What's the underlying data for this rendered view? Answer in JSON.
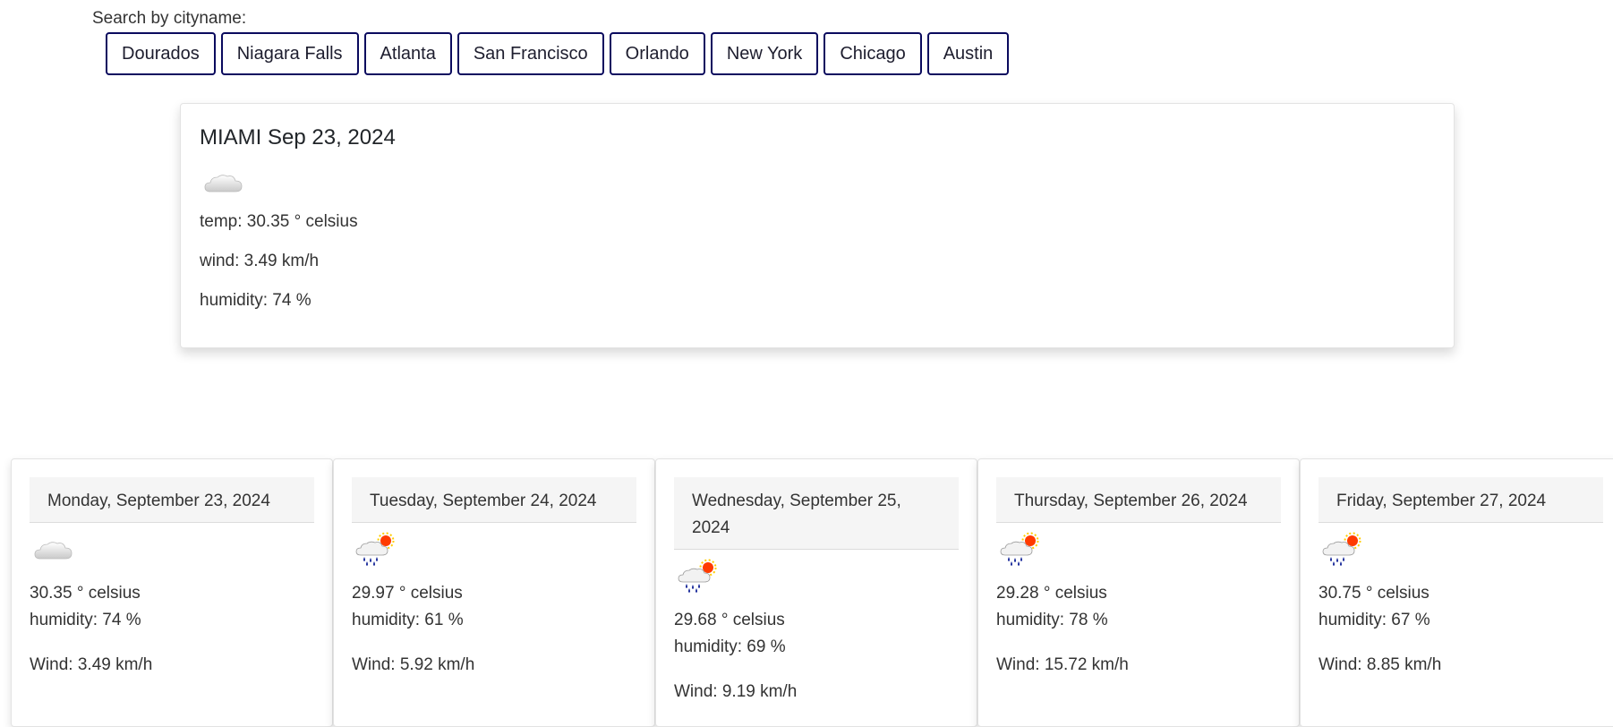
{
  "search": {
    "label": "Search by cityname:",
    "cities": [
      "Dourados",
      "Niagara Falls",
      "Atlanta",
      "San Francisco",
      "Orlando",
      "New York",
      "Chicago",
      "Austin"
    ]
  },
  "current": {
    "title": "MIAMI Sep 23, 2024",
    "icon": "cloud-icon",
    "temp": "temp: 30.35 ° celsius",
    "wind": "wind: 3.49 km/h",
    "humidity": "humidity: 74 %"
  },
  "forecast": [
    {
      "date": "Monday, September 23, 2024",
      "icon": "cloud-icon",
      "temp": "30.35 ° celsius",
      "humidity": "humidity: 74 %",
      "wind": "Wind: 3.49 km/h"
    },
    {
      "date": "Tuesday, September 24, 2024",
      "icon": "rain-sun-icon",
      "temp": "29.97 ° celsius",
      "humidity": "humidity: 61 %",
      "wind": "Wind: 5.92 km/h"
    },
    {
      "date": "Wednesday, September 25, 2024",
      "icon": "rain-sun-icon",
      "temp": "29.68 ° celsius",
      "humidity": "humidity: 69 %",
      "wind": "Wind: 9.19 km/h"
    },
    {
      "date": "Thursday, September 26, 2024",
      "icon": "rain-sun-icon",
      "temp": "29.28 ° celsius",
      "humidity": "humidity: 78 %",
      "wind": "Wind: 15.72 km/h"
    },
    {
      "date": "Friday, September 27, 2024",
      "icon": "rain-sun-icon",
      "temp": "30.75 ° celsius",
      "humidity": "humidity: 67 %",
      "wind": "Wind: 8.85 km/h"
    }
  ],
  "colors": {
    "button_border": "#0a0a5e",
    "card_header_bg": "#f5f5f5",
    "rain": "#1a2a9a",
    "sun": "#ff3b00"
  }
}
